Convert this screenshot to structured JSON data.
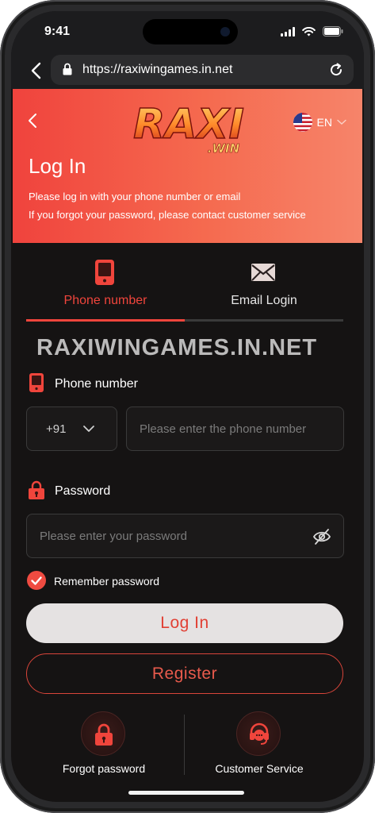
{
  "status_bar": {
    "time": "9:41"
  },
  "browser": {
    "url": "https://raxiwingames.in.net"
  },
  "hero": {
    "logo_text": "RAXI",
    "logo_sub": ".WIN",
    "language": "EN",
    "title": "Log In",
    "subtitle_line1": "Please log in with your phone number or email",
    "subtitle_line2": "If you forgot your password, please contact customer service"
  },
  "tabs": [
    {
      "label": "Phone number",
      "active": true
    },
    {
      "label": "Email Login",
      "active": false
    }
  ],
  "watermark": "RAXIWINGAMES.IN.NET",
  "form": {
    "phone_label": "Phone number",
    "country_code": "+91",
    "phone_placeholder": "Please enter the phone number",
    "password_label": "Password",
    "password_placeholder": "Please enter your password",
    "remember_label": "Remember password",
    "login_button": "Log In",
    "register_button": "Register"
  },
  "footer": {
    "forgot_label": "Forgot password",
    "service_label": "Customer Service"
  },
  "colors": {
    "accent": "#f0453c",
    "background": "#151313",
    "hero_gradient_start": "#f0433d",
    "hero_gradient_end": "#f6846a"
  }
}
